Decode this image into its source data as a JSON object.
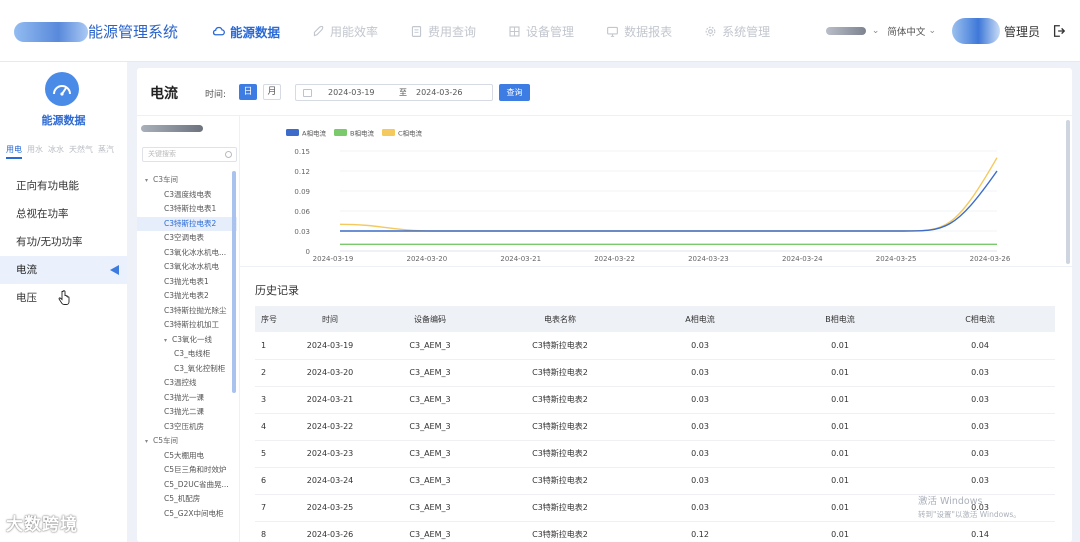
{
  "header": {
    "system_title": "能源管理系统",
    "nav": [
      {
        "label": "能源数据",
        "icon": "cloud-icon",
        "active": true
      },
      {
        "label": "用能效率",
        "icon": "rocket-icon",
        "active": false
      },
      {
        "label": "费用查询",
        "icon": "document-icon",
        "active": false
      },
      {
        "label": "设备管理",
        "icon": "grid-icon",
        "active": false
      },
      {
        "label": "数据报表",
        "icon": "monitor-icon",
        "active": false
      },
      {
        "label": "系统管理",
        "icon": "gear-icon",
        "active": false
      }
    ],
    "language": "简体中文",
    "user": "管理员",
    "accent_color": "#2a6ad6"
  },
  "sidebar": {
    "title": "能源数据",
    "energy_tabs": [
      "用电",
      "用水",
      "冰水",
      "天然气",
      "蒸汽"
    ],
    "active_energy_tab": "用电",
    "menu": [
      {
        "label": "正向有功电能",
        "active": false
      },
      {
        "label": "总视在功率",
        "active": false
      },
      {
        "label": "有功/无功功率",
        "active": false
      },
      {
        "label": "电流",
        "active": true
      },
      {
        "label": "电压",
        "active": false
      }
    ]
  },
  "toolbar": {
    "page_title": "电流",
    "time_label": "时间:",
    "day_label": "日",
    "month_label": "月",
    "start_date": "2024-03-19",
    "range_sep": "至",
    "end_date": "2024-03-26",
    "query_label": "查询"
  },
  "tree": {
    "search_placeholder": "关键搜索",
    "nodes": [
      {
        "label": "C3车间",
        "level": 0,
        "expanded": true
      },
      {
        "label": "C3温度线电表",
        "level": 1
      },
      {
        "label": "C3特斯拉电表1",
        "level": 1
      },
      {
        "label": "C3特斯拉电表2",
        "level": 1,
        "selected": true
      },
      {
        "label": "C3空调电表",
        "level": 1
      },
      {
        "label": "C3氧化冰水机电...",
        "level": 1
      },
      {
        "label": "C3氧化冰水机电",
        "level": 1
      },
      {
        "label": "C3抛光电表1",
        "level": 1
      },
      {
        "label": "C3抛光电表2",
        "level": 1
      },
      {
        "label": "C3特斯拉抛光除尘",
        "level": 1
      },
      {
        "label": "C3特斯拉机加工",
        "level": 1
      },
      {
        "label": "C3氧化一线",
        "level": 2,
        "expanded": true
      },
      {
        "label": "C3_电线柜",
        "level": 3
      },
      {
        "label": "C3_氧化控制柜",
        "level": 3
      },
      {
        "label": "C3温控线",
        "level": 1
      },
      {
        "label": "C3抛光一课",
        "level": 1
      },
      {
        "label": "C3抛光二课",
        "level": 1
      },
      {
        "label": "C3空压机房",
        "level": 1
      },
      {
        "label": "C5车间",
        "level": 0,
        "expanded": true
      },
      {
        "label": "C5大棚用电",
        "level": 1
      },
      {
        "label": "C5巨三角和时效炉",
        "level": 1
      },
      {
        "label": "C5_D2UC省曲晃...",
        "level": 1
      },
      {
        "label": "C5_机配房",
        "level": 1
      },
      {
        "label": "C5_G2X中间电柜",
        "level": 1
      }
    ]
  },
  "chart_data": {
    "type": "line",
    "title": "",
    "xlabel": "",
    "ylabel": "",
    "x": [
      "2024-03-19",
      "2024-03-20",
      "2024-03-21",
      "2024-03-22",
      "2024-03-23",
      "2024-03-24",
      "2024-03-25",
      "2024-03-26"
    ],
    "ylim": [
      0,
      0.15
    ],
    "yticks": [
      "0",
      "0.03",
      "0.06",
      "0.09",
      "0.12",
      "0.15"
    ],
    "legend_position": "top-left",
    "series": [
      {
        "name": "A相电流",
        "color": "#3c6bc9",
        "values": [
          0.03,
          0.03,
          0.03,
          0.03,
          0.03,
          0.03,
          0.03,
          0.12
        ]
      },
      {
        "name": "B相电流",
        "color": "#7ac96a",
        "values": [
          0.01,
          0.01,
          0.01,
          0.01,
          0.01,
          0.01,
          0.01,
          0.01
        ]
      },
      {
        "name": "C相电流",
        "color": "#f4c95d",
        "values": [
          0.04,
          0.03,
          0.03,
          0.03,
          0.03,
          0.03,
          0.03,
          0.14
        ]
      }
    ]
  },
  "history": {
    "title": "历史记录",
    "columns": [
      "序号",
      "时间",
      "设备编码",
      "电表名称",
      "A相电流",
      "B相电流",
      "C相电流"
    ],
    "rows": [
      [
        "1",
        "2024-03-19",
        "C3_AEM_3",
        "C3特斯拉电表2",
        "0.03",
        "0.01",
        "0.04"
      ],
      [
        "2",
        "2024-03-20",
        "C3_AEM_3",
        "C3特斯拉电表2",
        "0.03",
        "0.01",
        "0.03"
      ],
      [
        "3",
        "2024-03-21",
        "C3_AEM_3",
        "C3特斯拉电表2",
        "0.03",
        "0.01",
        "0.03"
      ],
      [
        "4",
        "2024-03-22",
        "C3_AEM_3",
        "C3特斯拉电表2",
        "0.03",
        "0.01",
        "0.03"
      ],
      [
        "5",
        "2024-03-23",
        "C3_AEM_3",
        "C3特斯拉电表2",
        "0.03",
        "0.01",
        "0.03"
      ],
      [
        "6",
        "2024-03-24",
        "C3_AEM_3",
        "C3特斯拉电表2",
        "0.03",
        "0.01",
        "0.03"
      ],
      [
        "7",
        "2024-03-25",
        "C3_AEM_3",
        "C3特斯拉电表2",
        "0.03",
        "0.01",
        "0.03"
      ],
      [
        "8",
        "2024-03-26",
        "C3_AEM_3",
        "C3特斯拉电表2",
        "0.12",
        "0.01",
        "0.14"
      ]
    ]
  },
  "overlay": {
    "watermark": "大数跨境",
    "activate_title": "激活 Windows",
    "activate_sub": "转到\"设置\"以激活 Windows。"
  }
}
